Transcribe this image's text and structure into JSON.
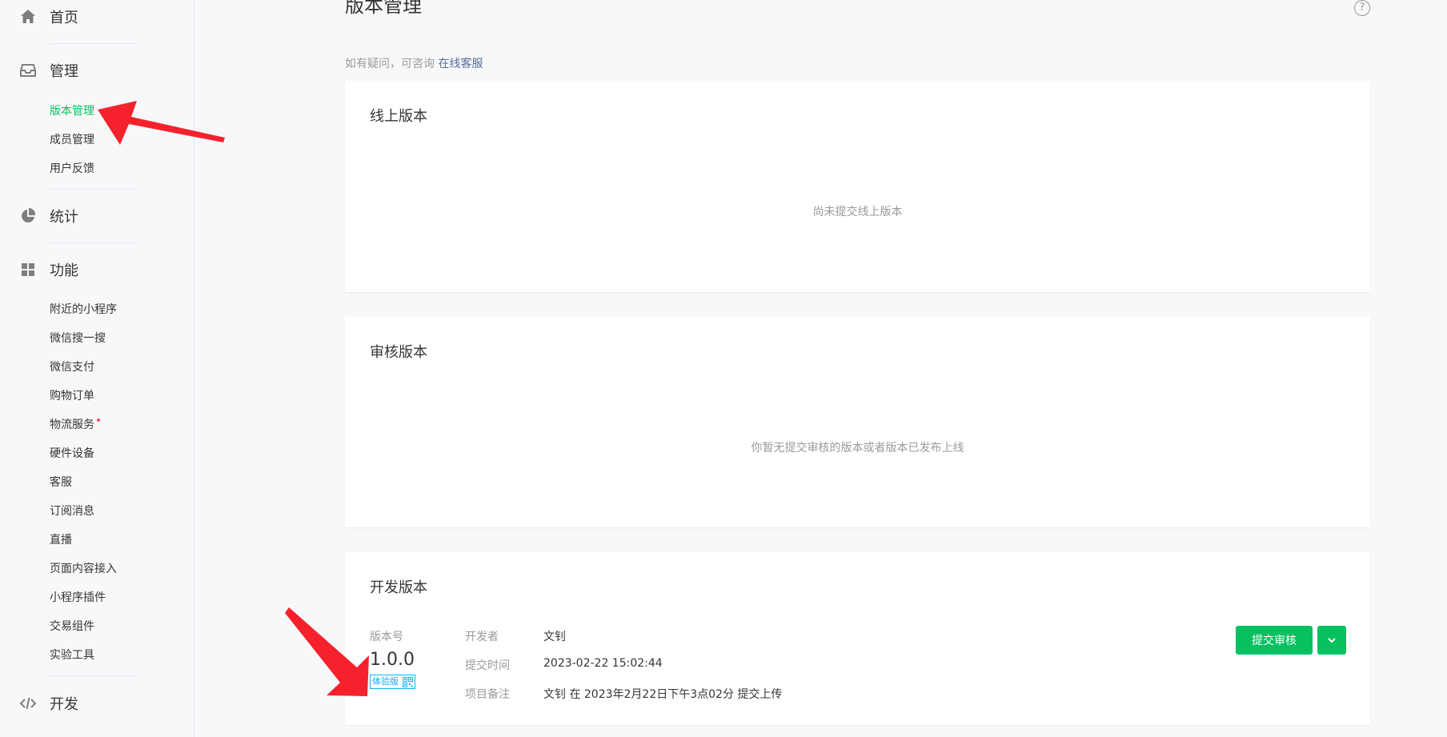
{
  "sidebar": {
    "home": {
      "label": "首页",
      "icon": "home-icon"
    },
    "manage": {
      "label": "管理",
      "icon": "inbox-icon",
      "items": [
        "版本管理",
        "成员管理",
        "用户反馈"
      ]
    },
    "stats": {
      "label": "统计",
      "icon": "pie-chart-icon"
    },
    "features": {
      "label": "功能",
      "icon": "grid-icon",
      "items": [
        "附近的小程序",
        "微信搜一搜",
        "微信支付",
        "购物订单",
        "物流服务",
        "硬件设备",
        "客服",
        "订阅消息",
        "直播",
        "页面内容接入",
        "小程序插件",
        "交易组件",
        "实验工具"
      ]
    },
    "dev": {
      "label": "开发",
      "icon": "code-icon"
    }
  },
  "main": {
    "title": "版本管理",
    "tip_text": "如有疑问，可咨询",
    "tip_link": "在线客服",
    "online": {
      "title": "线上版本",
      "empty": "尚未提交线上版本"
    },
    "review": {
      "title": "审核版本",
      "empty": "你暂无提交审核的版本或者版本已发布上线"
    },
    "dev_version": {
      "title": "开发版本",
      "version_label": "版本号",
      "version": "1.0.0",
      "tag": "体验版",
      "developer_label": "开发者",
      "developer": "文钊",
      "submit_time_label": "提交时间",
      "submit_time": "2023-02-22 15:02:44",
      "note_label": "项目备注",
      "note": "文钊 在 2023年2月22日下午3点02分 提交上传",
      "submit_button": "提交审核"
    }
  },
  "colors": {
    "accent": "#07c160",
    "link": "#576b95",
    "tag": "#10aeff",
    "annotation": "#f5222d"
  }
}
